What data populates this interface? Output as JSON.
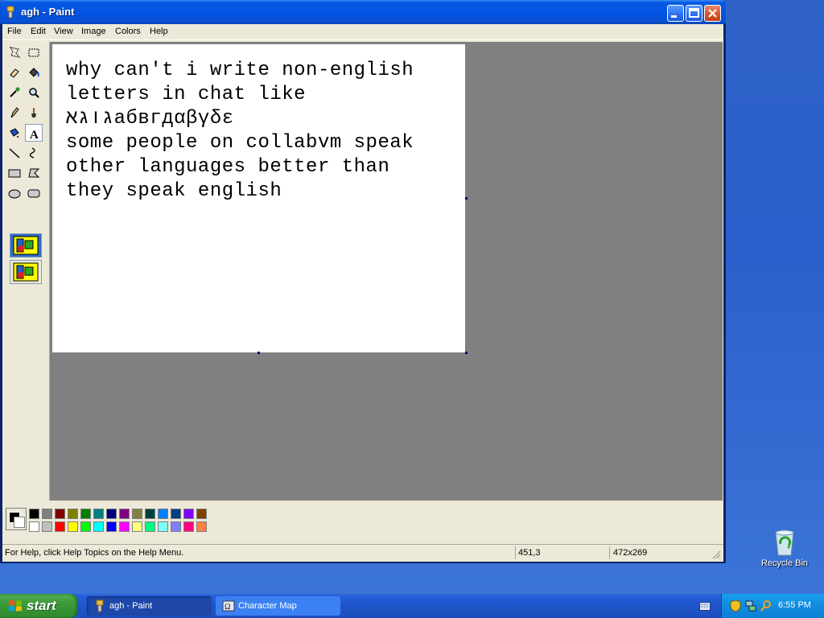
{
  "window": {
    "title": "agh - Paint"
  },
  "menu": [
    {
      "label": "File"
    },
    {
      "label": "Edit"
    },
    {
      "label": "View"
    },
    {
      "label": "Image"
    },
    {
      "label": "Colors"
    },
    {
      "label": "Help"
    }
  ],
  "canvas": {
    "text": "why can't i write non-english\nletters in chat like\nגוגאабвгдαβγδε\nsome people on collabvm speak\nother languages better than\nthey speak english"
  },
  "status": {
    "help": "For Help, click Help Topics on the Help Menu.",
    "cursor_position": "451,3",
    "canvas_size": "472x269"
  },
  "desktop": {
    "recycle_bin_label": "Recycle Bin"
  },
  "taskbar": {
    "start_label": "start",
    "tasks": [
      {
        "label": "agh - Paint",
        "active": true
      },
      {
        "label": "Character Map",
        "active": false
      }
    ],
    "clock": "6:55 PM"
  },
  "palette": {
    "foreground": "#000000",
    "background": "#ffffff",
    "top_row": [
      "#000000",
      "#808080",
      "#800000",
      "#808000",
      "#008000",
      "#008080",
      "#000080",
      "#800080",
      "#808040",
      "#004040",
      "#0080ff",
      "#004080",
      "#8000ff",
      "#804000"
    ],
    "bottom_row": [
      "#ffffff",
      "#c0c0c0",
      "#ff0000",
      "#ffff00",
      "#00ff00",
      "#00ffff",
      "#0000ff",
      "#ff00ff",
      "#ffff80",
      "#00ff80",
      "#80ffff",
      "#8080ff",
      "#ff0080",
      "#ff8040"
    ]
  },
  "tools": [
    "free-form-select",
    "select",
    "eraser",
    "fill-with-color",
    "pick-color",
    "magnifier",
    "pencil",
    "brush",
    "airbrush",
    "text",
    "line",
    "curve",
    "rectangle",
    "polygon",
    "ellipse",
    "rounded-rectangle"
  ],
  "active_tool": "text"
}
